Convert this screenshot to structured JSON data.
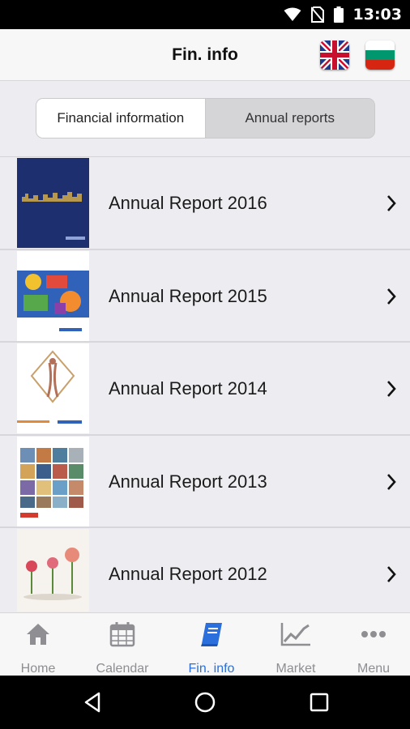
{
  "status_bar": {
    "time": "13:03",
    "icons": [
      "wifi-icon",
      "no-sim-icon",
      "battery-icon"
    ]
  },
  "header": {
    "title": "Fin. info",
    "languages": [
      {
        "name": "uk-flag-icon"
      },
      {
        "name": "bulgaria-flag-icon"
      }
    ]
  },
  "segment": {
    "tabs": [
      {
        "label": "Financial information",
        "selected": true
      },
      {
        "label": "Annual reports",
        "selected": false
      }
    ]
  },
  "reports": [
    {
      "title": "Annual Report 2016",
      "cover_icon": "report-cover-2016"
    },
    {
      "title": "Annual Report 2015",
      "cover_icon": "report-cover-2015"
    },
    {
      "title": "Annual Report 2014",
      "cover_icon": "report-cover-2014"
    },
    {
      "title": "Annual Report 2013",
      "cover_icon": "report-cover-2013"
    },
    {
      "title": "Annual Report 2012",
      "cover_icon": "report-cover-2012"
    }
  ],
  "tab_bar": {
    "items": [
      {
        "label": "Home",
        "icon": "home-icon"
      },
      {
        "label": "Calendar",
        "icon": "calendar-icon"
      },
      {
        "label": "Fin. info",
        "icon": "book-icon",
        "active": true
      },
      {
        "label": "Market",
        "icon": "chart-icon"
      },
      {
        "label": "Menu",
        "icon": "more-icon"
      }
    ]
  },
  "colors": {
    "accent": "#2a6fdb",
    "inactive_tab": "#8e8e93",
    "background": "#ededf1"
  },
  "nav_bar": {
    "icons": [
      "back-icon",
      "home-circle-icon",
      "recents-icon"
    ]
  }
}
